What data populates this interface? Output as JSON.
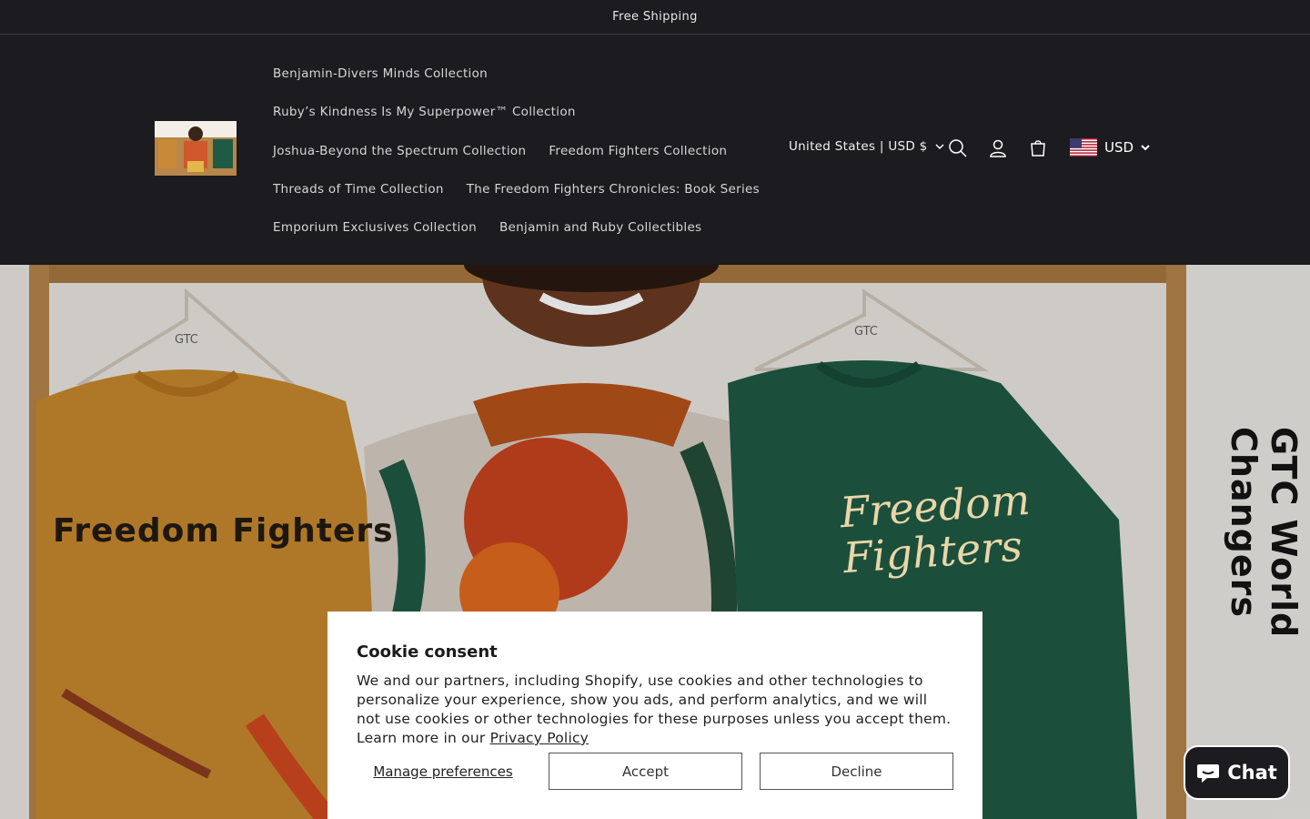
{
  "announcement": {
    "text": "Free Shipping"
  },
  "header": {
    "logo_alt": "store logo",
    "nav": [
      [
        "Benjamin-Divers Minds Collection"
      ],
      [
        "Ruby’s Kindness Is My Superpower™ Collection"
      ],
      [
        "Joshua-Beyond the Spectrum Collection",
        "Freedom Fighters Collection"
      ],
      [
        "Threads of Time Collection",
        "The Freedom Fighters Chronicles: Book Series"
      ],
      [
        "Emporium Exclusives Collection",
        "Benjamin and Ruby Collectibles"
      ]
    ],
    "country_selector": "United States | USD $",
    "currency": "USD",
    "icons": [
      "search-icon",
      "account-icon",
      "cart-icon",
      "us-flag-icon",
      "chevron-down-icon"
    ]
  },
  "hero": {
    "left_shirt_text": "Freedom Fighters",
    "right_shirt_text_line1": "Freedom",
    "right_shirt_text_line2": "Fighters",
    "vertical_text": "GTC World Changers",
    "hanger_label": "GTC"
  },
  "cookie": {
    "title": "Cookie consent",
    "body": "We and our partners, including Shopify, use cookies and other technologies to personalize your experience, show you ads, and perform analytics, and we will not use cookies or other technologies for these purposes unless you accept them. Learn more in our",
    "privacy_link": "Privacy Policy",
    "manage": "Manage preferences",
    "accept": "Accept",
    "decline": "Decline"
  },
  "chat": {
    "label": "Chat"
  },
  "colors": {
    "header_bg": "#1c1b1f",
    "sweater_orange": "#c8892e",
    "sweater_green": "#1f5a45",
    "cookie_bg": "#ffffff"
  }
}
